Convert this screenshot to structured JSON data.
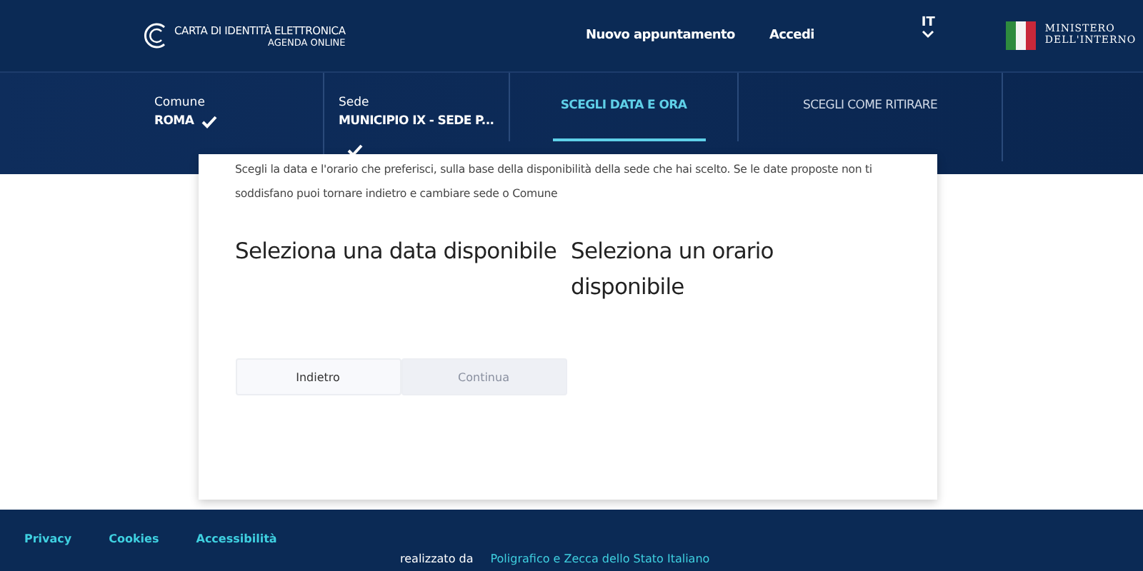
{
  "header": {
    "logo_title": "CARTA DI IDENTITÀ ELETTRONICA",
    "logo_subtitle": "AGENDA ONLINE",
    "nav": [
      "Nuovo appuntamento",
      "Accedi"
    ],
    "language": "IT",
    "ministry": [
      "MINISTERO",
      "DELL'INTERNO"
    ]
  },
  "steps": [
    {
      "kind": "summary",
      "label": "Comune",
      "value": "ROMA",
      "done": true
    },
    {
      "kind": "summary",
      "label": "Sede",
      "value": "MUNICIPIO IX - SEDE P...",
      "done": true
    },
    {
      "kind": "title",
      "value": "SCEGLI DATA E ORA",
      "selected": true
    },
    {
      "kind": "title",
      "value": "SCEGLI COME RITIRARE",
      "selected": false
    }
  ],
  "intro": "Scegli la data e l'orario che preferisci, sulla base della disponibilità della sede che hai scelto. Se le date proposte non ti soddisfano puoi tornare indietro e cambiare sede o Comune",
  "headings": [
    "Seleziona una data disponibile",
    "Seleziona un orario disponibile"
  ],
  "buttons": [
    {
      "label": "Indietro",
      "disabled": false
    },
    {
      "label": "Continua",
      "disabled": true
    }
  ],
  "footer": {
    "links": [
      "Privacy",
      "Cookies",
      "Accessibilità"
    ],
    "credit": "realizzato da",
    "credit_link": "Poligrafico e Zecca dello Stato Italiano"
  }
}
